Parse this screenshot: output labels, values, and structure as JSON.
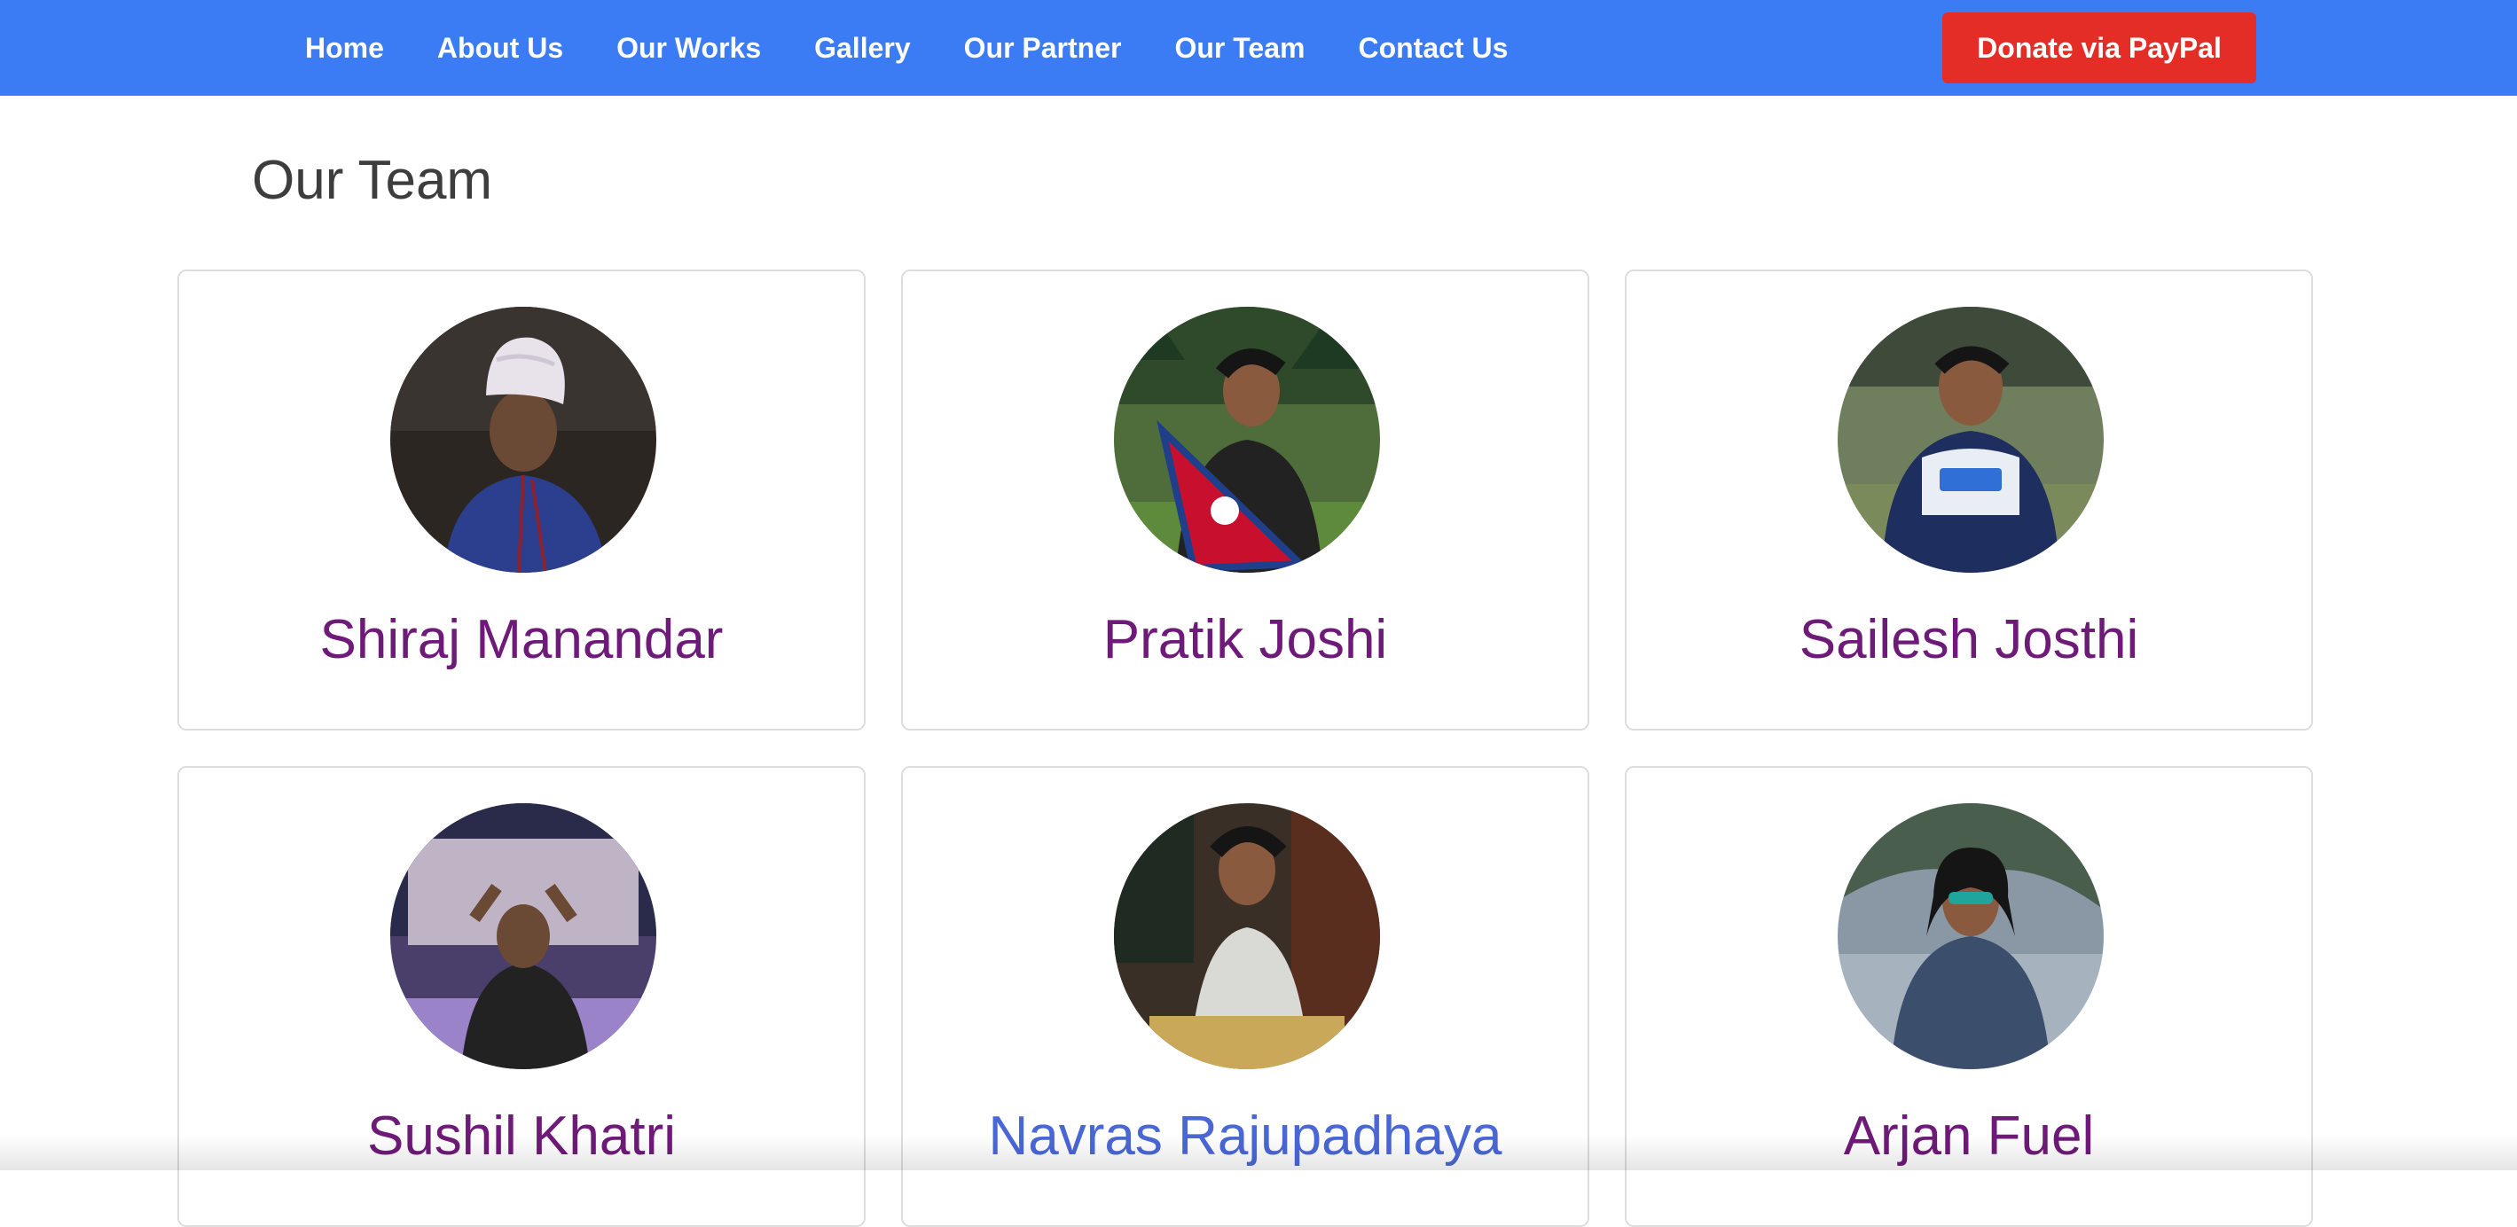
{
  "nav": {
    "items": [
      {
        "label": "Home"
      },
      {
        "label": "About Us"
      },
      {
        "label": "Our Works"
      },
      {
        "label": "Gallery"
      },
      {
        "label": "Our Partner"
      },
      {
        "label": "Our Team"
      },
      {
        "label": "Contact Us"
      }
    ],
    "donate_label": "Donate via PayPal"
  },
  "page": {
    "title": "Our Team"
  },
  "team": [
    {
      "name": "Shiraj Manandar"
    },
    {
      "name": "Pratik Joshi"
    },
    {
      "name": "Sailesh Josthi"
    },
    {
      "name": "Sushil Khatri"
    },
    {
      "name": "Navras Rajupadhaya"
    },
    {
      "name": "Arjan Fuel"
    }
  ],
  "colors": {
    "nav_bg": "#3b7cf5",
    "donate_bg": "#e52d27",
    "name_purple": "#6e1a78",
    "name_blue": "#4a67d6"
  }
}
